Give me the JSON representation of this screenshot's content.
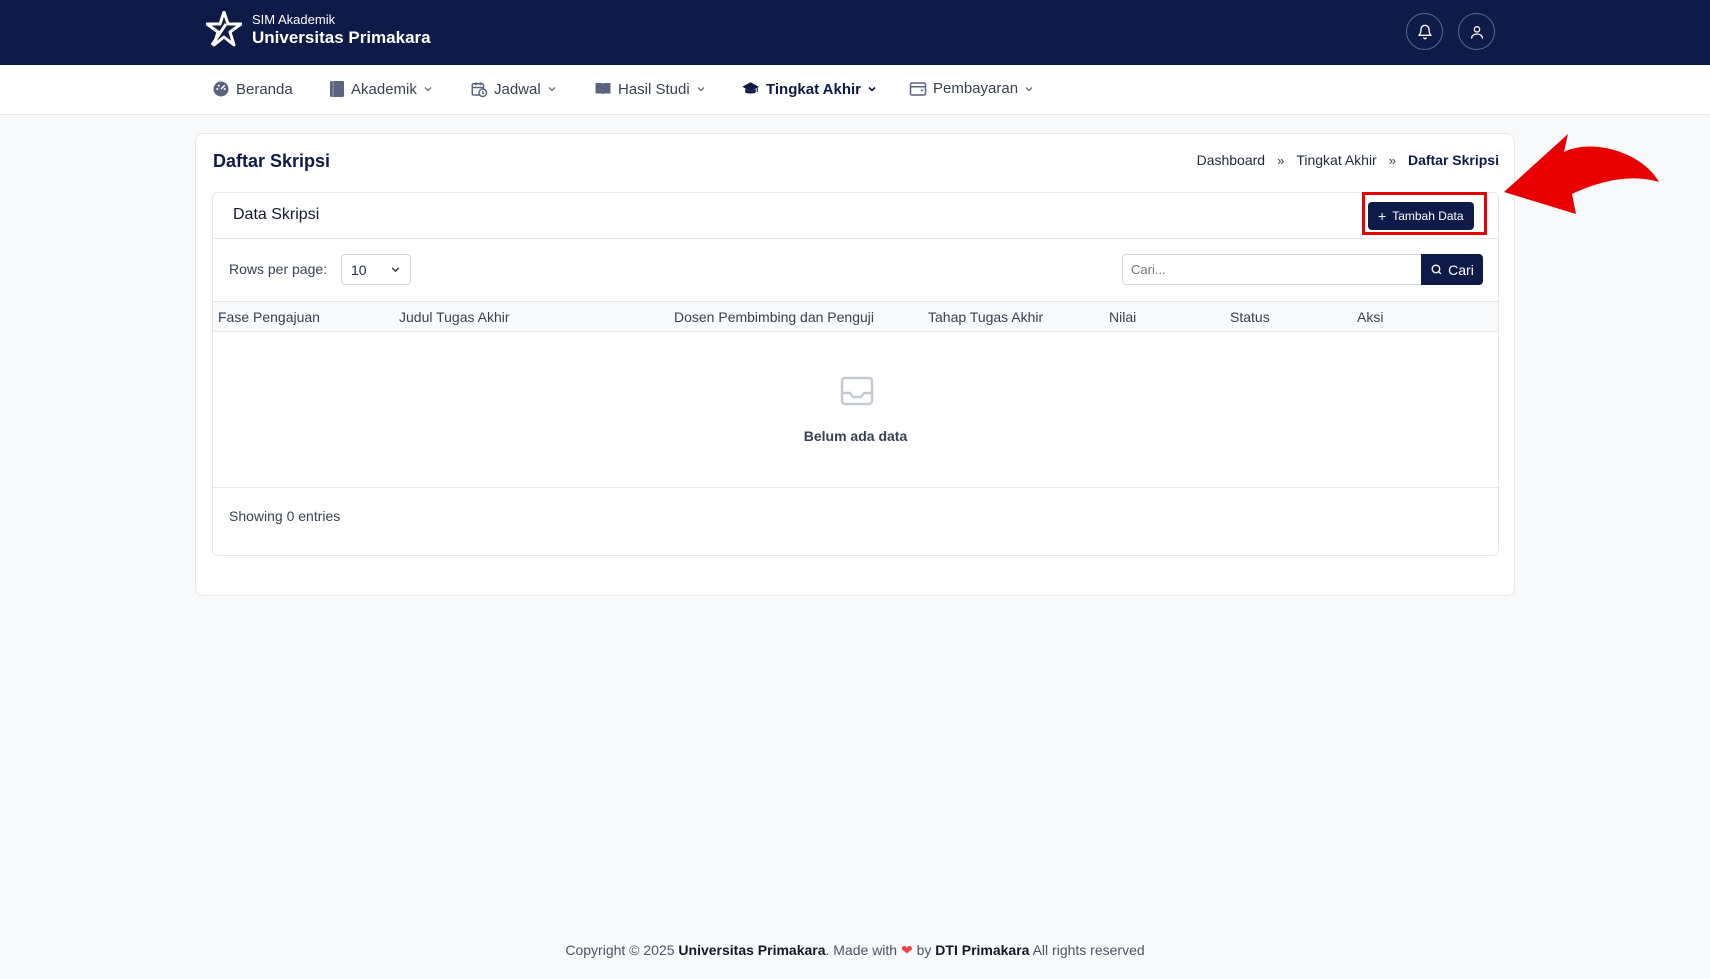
{
  "brand": {
    "subtitle": "SIM Akademik",
    "name": "Universitas Primakara"
  },
  "header": {
    "icons": [
      "bell-icon",
      "user-icon"
    ]
  },
  "nav": {
    "items": [
      {
        "label": "Beranda",
        "icon": "dashboard-icon",
        "has_dropdown": false
      },
      {
        "label": "Akademik",
        "icon": "book-icon",
        "has_dropdown": true
      },
      {
        "label": "Jadwal",
        "icon": "calendar-icon",
        "has_dropdown": true
      },
      {
        "label": "Hasil Studi",
        "icon": "open-book-icon",
        "has_dropdown": true
      },
      {
        "label": "Tingkat Akhir",
        "icon": "graduation-cap-icon",
        "has_dropdown": true,
        "active": true
      },
      {
        "label": "Pembayaran",
        "icon": "wallet-icon",
        "has_dropdown": true
      }
    ]
  },
  "page": {
    "title": "Daftar Skripsi",
    "breadcrumb": [
      "Dashboard",
      "Tingkat Akhir",
      "Daftar Skripsi"
    ],
    "breadcrumb_sep": "»"
  },
  "table_card": {
    "title": "Data Skripsi",
    "add_button": "Tambah Data",
    "rows_label": "Rows per page:",
    "rows_value": "10",
    "search_placeholder": "Cari...",
    "search_button": "Cari",
    "columns": [
      "Fase Pengajuan",
      "Judul Tugas Akhir",
      "Dosen Pembimbing dan Penguji",
      "Tahap Tugas Akhir",
      "Nilai",
      "Status",
      "Aksi"
    ],
    "rows": [],
    "empty_text": "Belum ada data",
    "showing_text": "Showing 0 entries"
  },
  "footer": {
    "prefix": "Copyright © 2025",
    "org": "Universitas Primakara",
    "made_with": ". Made with",
    "by": "by",
    "team": "DTI Primakara",
    "suffix": "All rights reserved"
  },
  "colors": {
    "primary": "#0e1a47",
    "highlight": "#e80000",
    "heart": "#ef4444"
  }
}
